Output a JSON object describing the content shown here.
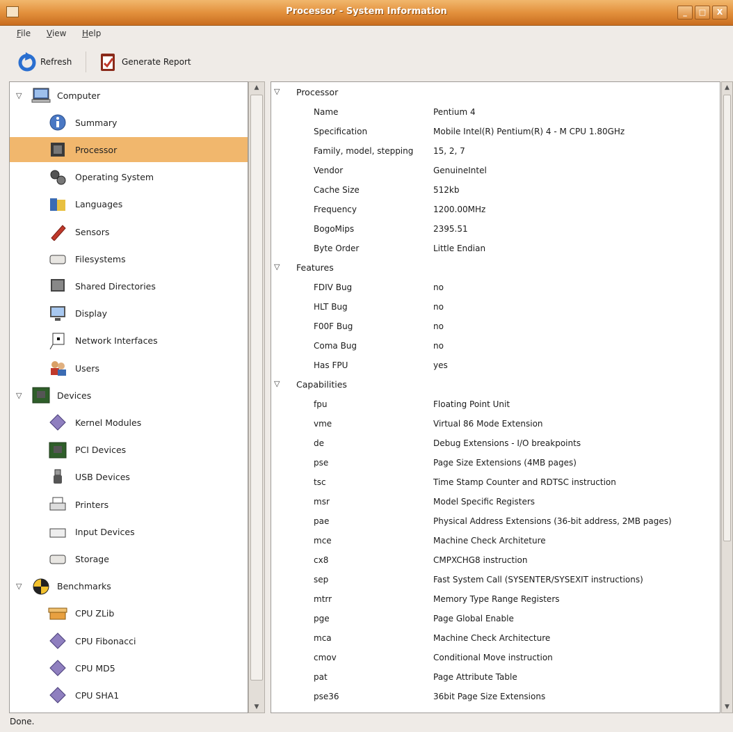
{
  "window": {
    "title": "Processor - System Information",
    "buttons": [
      "_",
      "□",
      "X"
    ]
  },
  "menu": [
    {
      "label": "File",
      "u": "F",
      "rest": "ile"
    },
    {
      "label": "View",
      "u": "V",
      "rest": "iew"
    },
    {
      "label": "Help",
      "u": "H",
      "rest": "elp"
    }
  ],
  "toolbar": {
    "refresh": "Refresh",
    "report": "Generate Report"
  },
  "tree": [
    {
      "label": "Computer",
      "level": 0,
      "expanded": true,
      "icon": "computer-icon"
    },
    {
      "label": "Summary",
      "level": 1,
      "icon": "info-icon"
    },
    {
      "label": "Processor",
      "level": 1,
      "icon": "processor-icon",
      "selected": true
    },
    {
      "label": "Operating System",
      "level": 1,
      "icon": "gears-icon"
    },
    {
      "label": "Languages",
      "level": 1,
      "icon": "languages-icon"
    },
    {
      "label": "Sensors",
      "level": 1,
      "icon": "sensor-icon"
    },
    {
      "label": "Filesystems",
      "level": 1,
      "icon": "drive-icon"
    },
    {
      "label": "Shared Directories",
      "level": 1,
      "icon": "folder-icon"
    },
    {
      "label": "Display",
      "level": 1,
      "icon": "monitor-icon"
    },
    {
      "label": "Network Interfaces",
      "level": 1,
      "icon": "network-icon"
    },
    {
      "label": "Users",
      "level": 1,
      "icon": "users-icon"
    },
    {
      "label": "Devices",
      "level": 0,
      "expanded": true,
      "icon": "board-icon"
    },
    {
      "label": "Kernel Modules",
      "level": 1,
      "icon": "module-icon"
    },
    {
      "label": "PCI Devices",
      "level": 1,
      "icon": "board-icon"
    },
    {
      "label": "USB Devices",
      "level": 1,
      "icon": "usb-icon"
    },
    {
      "label": "Printers",
      "level": 1,
      "icon": "printer-icon"
    },
    {
      "label": "Input Devices",
      "level": 1,
      "icon": "keyboard-icon"
    },
    {
      "label": "Storage",
      "level": 1,
      "icon": "drive-icon"
    },
    {
      "label": "Benchmarks",
      "level": 0,
      "expanded": true,
      "icon": "benchmark-icon"
    },
    {
      "label": "CPU ZLib",
      "level": 1,
      "icon": "box-icon"
    },
    {
      "label": "CPU Fibonacci",
      "level": 1,
      "icon": "module-icon"
    },
    {
      "label": "CPU MD5",
      "level": 1,
      "icon": "module-icon"
    },
    {
      "label": "CPU SHA1",
      "level": 1,
      "icon": "module-icon"
    }
  ],
  "details": [
    {
      "section": "Processor"
    },
    {
      "k": "Name",
      "v": "Pentium 4"
    },
    {
      "k": "Specification",
      "v": "Mobile Intel(R) Pentium(R) 4 - M CPU 1.80GHz"
    },
    {
      "k": "Family, model, stepping",
      "v": "15, 2, 7"
    },
    {
      "k": "Vendor",
      "v": "GenuineIntel"
    },
    {
      "k": "Cache Size",
      "v": "512kb"
    },
    {
      "k": "Frequency",
      "v": "1200.00MHz"
    },
    {
      "k": "BogoMips",
      "v": "2395.51"
    },
    {
      "k": "Byte Order",
      "v": "Little Endian"
    },
    {
      "section": "Features"
    },
    {
      "k": "FDIV Bug",
      "v": "no"
    },
    {
      "k": "HLT Bug",
      "v": "no"
    },
    {
      "k": "F00F Bug",
      "v": "no"
    },
    {
      "k": "Coma Bug",
      "v": "no"
    },
    {
      "k": "Has FPU",
      "v": "yes"
    },
    {
      "section": "Capabilities"
    },
    {
      "k": "fpu",
      "v": "Floating Point Unit"
    },
    {
      "k": "vme",
      "v": "Virtual 86 Mode Extension"
    },
    {
      "k": "de",
      "v": "Debug Extensions - I/O breakpoints"
    },
    {
      "k": "pse",
      "v": "Page Size Extensions (4MB pages)"
    },
    {
      "k": "tsc",
      "v": "Time Stamp Counter and RDTSC instruction"
    },
    {
      "k": "msr",
      "v": "Model Specific Registers"
    },
    {
      "k": "pae",
      "v": "Physical Address Extensions (36-bit address, 2MB pages)"
    },
    {
      "k": "mce",
      "v": "Machine Check Architeture"
    },
    {
      "k": "cx8",
      "v": "CMPXCHG8 instruction"
    },
    {
      "k": "sep",
      "v": "Fast System Call (SYSENTER/SYSEXIT instructions)"
    },
    {
      "k": "mtrr",
      "v": "Memory Type Range Registers"
    },
    {
      "k": "pge",
      "v": "Page Global Enable"
    },
    {
      "k": "mca",
      "v": "Machine Check Architecture"
    },
    {
      "k": "cmov",
      "v": "Conditional Move instruction"
    },
    {
      "k": "pat",
      "v": "Page Attribute Table"
    },
    {
      "k": "pse36",
      "v": "36bit Page Size Extensions"
    }
  ],
  "status": "Done.",
  "colors": {
    "titlebar": "#e3913d",
    "selection": "#f1b76d"
  }
}
